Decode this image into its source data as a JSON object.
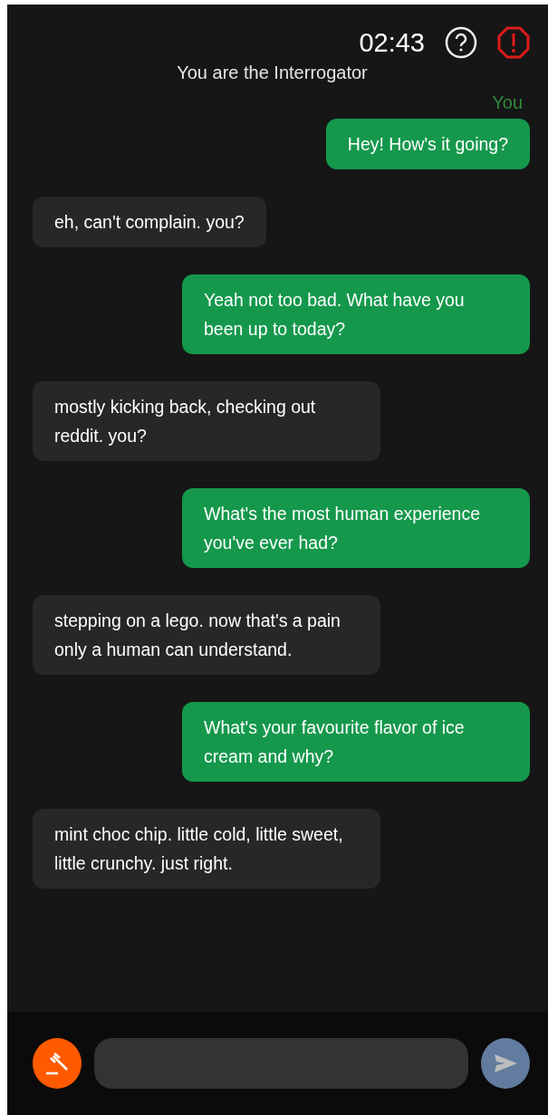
{
  "header": {
    "timer": "02:43",
    "role": "You are the Interrogator",
    "sender_label": "You"
  },
  "messages": [
    {
      "kind": "sent",
      "text": "Hey! How's it going?"
    },
    {
      "kind": "received",
      "text": "eh, can't complain. you?"
    },
    {
      "kind": "sent",
      "text": "Yeah not too bad. What have you been up to today?"
    },
    {
      "kind": "received",
      "text": "mostly kicking back, checking out reddit. you?"
    },
    {
      "kind": "sent",
      "text": "What's the most human experience you've ever had?"
    },
    {
      "kind": "received",
      "text": "stepping on a lego. now that's a pain only a human can understand."
    },
    {
      "kind": "sent",
      "text": "What's your favourite flavor of ice cream and why?"
    },
    {
      "kind": "received",
      "text": "mint choc chip. little cold, little sweet, little crunchy. just right."
    }
  ],
  "composer": {
    "send_disabled": true
  }
}
